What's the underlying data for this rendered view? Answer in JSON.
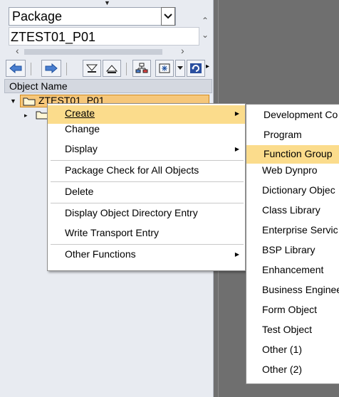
{
  "package_type": {
    "value": "Package"
  },
  "package_name": {
    "value": "ZTEST01_P01"
  },
  "tree": {
    "header": "Object Name",
    "root_node": "ZTEST01_P01"
  },
  "context_menu": {
    "items": [
      {
        "label": "Create",
        "mnemonic_index": 0,
        "has_submenu": true,
        "highlighted": true
      },
      {
        "label": "Change",
        "mnemonic_index": 0,
        "has_submenu": false
      },
      {
        "label": "Display",
        "mnemonic_index": 0,
        "has_submenu": true
      },
      {
        "label": "Package Check for All Objects",
        "mnemonic_index": 0,
        "has_submenu": false
      },
      {
        "label": "Delete",
        "mnemonic_index": 0,
        "has_submenu": false
      },
      {
        "label": "Display Object Directory Entry",
        "mnemonic_index": 0,
        "has_submenu": false
      },
      {
        "label": "Write Transport Entry",
        "mnemonic_index": 6,
        "has_submenu": false
      },
      {
        "label": "Other Functions",
        "mnemonic_index": 0,
        "has_submenu": true
      }
    ]
  },
  "create_submenu": {
    "items": [
      {
        "label": "Development Co",
        "highlighted": false
      },
      {
        "label": "Program",
        "highlighted": false
      },
      {
        "label": "Function Group",
        "highlighted": true
      },
      {
        "label": "Web Dynpro",
        "highlighted": false
      },
      {
        "label": "Dictionary Objec",
        "highlighted": false
      },
      {
        "label": "Class Library",
        "highlighted": false
      },
      {
        "label": "Enterprise Servic",
        "highlighted": false
      },
      {
        "label": "BSP Library",
        "highlighted": false
      },
      {
        "label": "Enhancement",
        "highlighted": false
      },
      {
        "label": "Business Enginee",
        "highlighted": false
      },
      {
        "label": "Form Object",
        "highlighted": false
      },
      {
        "label": "Test Object",
        "highlighted": false
      },
      {
        "label": "Other (1)",
        "highlighted": false
      },
      {
        "label": "Other (2)",
        "highlighted": false
      }
    ]
  },
  "colors": {
    "menu_highlight": "#fbdc8c",
    "tree_selection": "#f6c77a",
    "panel_bg": "#e8ebf1",
    "dark_area": "#6f6f6f"
  },
  "icons": [
    "dropdown-arrow-icon",
    "back-arrow-icon",
    "forward-arrow-icon",
    "expand-icon",
    "collapse-icon",
    "hierarchy-icon",
    "select-icon",
    "refresh-icon",
    "folder-icon"
  ]
}
